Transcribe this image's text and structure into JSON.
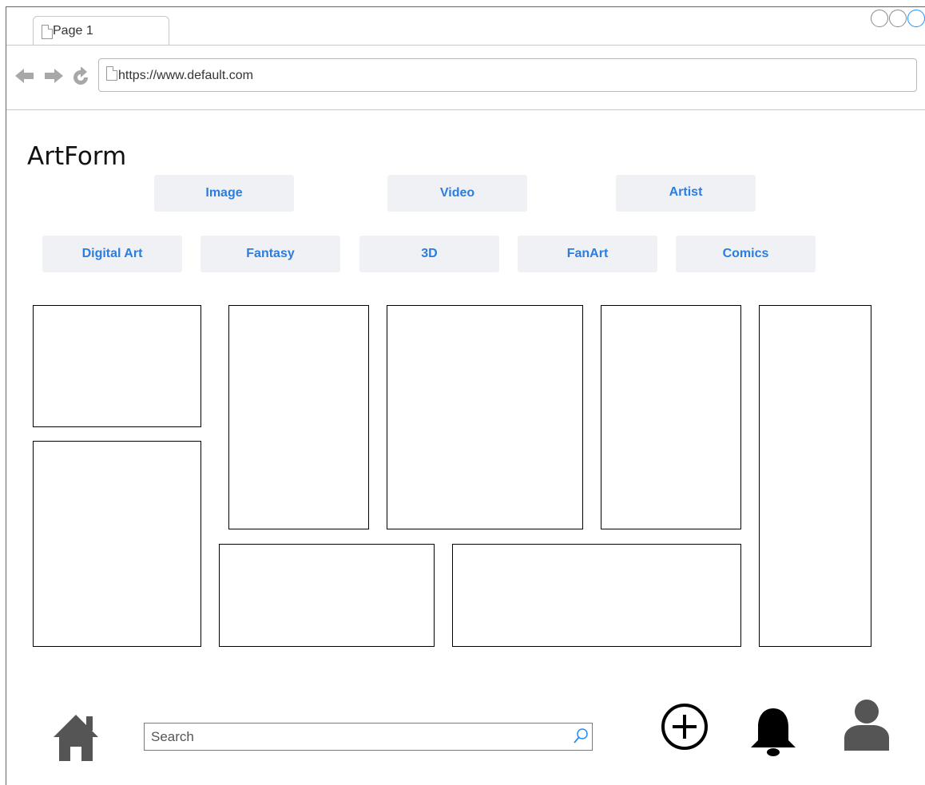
{
  "browser": {
    "tab_title": "Page 1",
    "url": "https://www.default.com"
  },
  "app": {
    "title": "ArtForm"
  },
  "media_tabs": [
    "Image",
    "Video",
    "Artist"
  ],
  "categories": [
    "Digital Art",
    "Fantasy",
    "3D",
    "FanArt",
    "Comics"
  ],
  "bottom_bar": {
    "search_placeholder": "Search"
  },
  "colors": {
    "link_blue": "#2a7de1",
    "pill_bg": "#eff1f5",
    "icon_gray": "#555555"
  }
}
